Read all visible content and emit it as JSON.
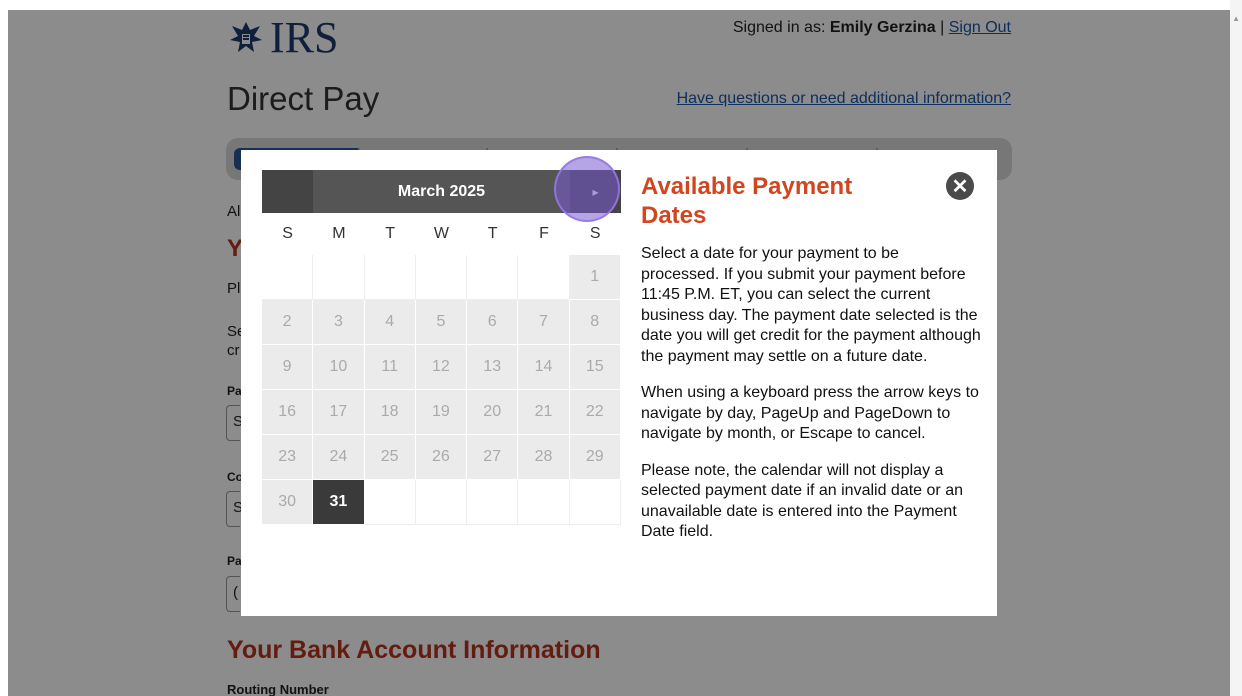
{
  "header": {
    "logo_text": "IRS",
    "signed_in_prefix": "Signed in as:",
    "user_name": "Emily Gerzina",
    "separator": "|",
    "sign_out": "Sign Out",
    "page_title": "Direct Pay",
    "help_link": "Have questions or need additional information?"
  },
  "background": {
    "fragments": [
      "Al",
      "Y",
      "Pl",
      "Se",
      "cr",
      "Pa",
      "S",
      "Co",
      "S",
      "Pa",
      "("
    ],
    "bank_heading": "Your Bank Account Information",
    "routing_label": "Routing Number"
  },
  "calendar": {
    "month_label": "March 2025",
    "next_icon": "▸",
    "weekdays": [
      "S",
      "M",
      "T",
      "W",
      "T",
      "F",
      "S"
    ],
    "weeks": [
      [
        "",
        "",
        "",
        "",
        "",
        "",
        "1"
      ],
      [
        "2",
        "3",
        "4",
        "5",
        "6",
        "7",
        "8"
      ],
      [
        "9",
        "10",
        "11",
        "12",
        "13",
        "14",
        "15"
      ],
      [
        "16",
        "17",
        "18",
        "19",
        "20",
        "21",
        "22"
      ],
      [
        "23",
        "24",
        "25",
        "26",
        "27",
        "28",
        "29"
      ],
      [
        "30",
        "31",
        "",
        "",
        "",
        "",
        ""
      ]
    ],
    "selected_day": "31"
  },
  "info_panel": {
    "title": "Available Payment Dates",
    "close_icon": "✕",
    "paragraphs": [
      "Select a date for your payment to be processed. If you submit your payment before 11:45 P.M. ET, you can select the current business day. The payment date selected is the date you will get credit for the payment although the payment may settle on a future date.",
      "When using a keyboard press the arrow keys to navigate by day, PageUp and PageDown to navigate by month, or Escape to cancel.",
      "Please note, the calendar will not display a selected payment date if an invalid date or an unavailable date is entered into the Payment Date field."
    ]
  },
  "colors": {
    "accent_red": "#d1461f",
    "link_blue": "#1a56a8",
    "calendar_header": "#555555",
    "selected_day": "#3a3a3a"
  }
}
